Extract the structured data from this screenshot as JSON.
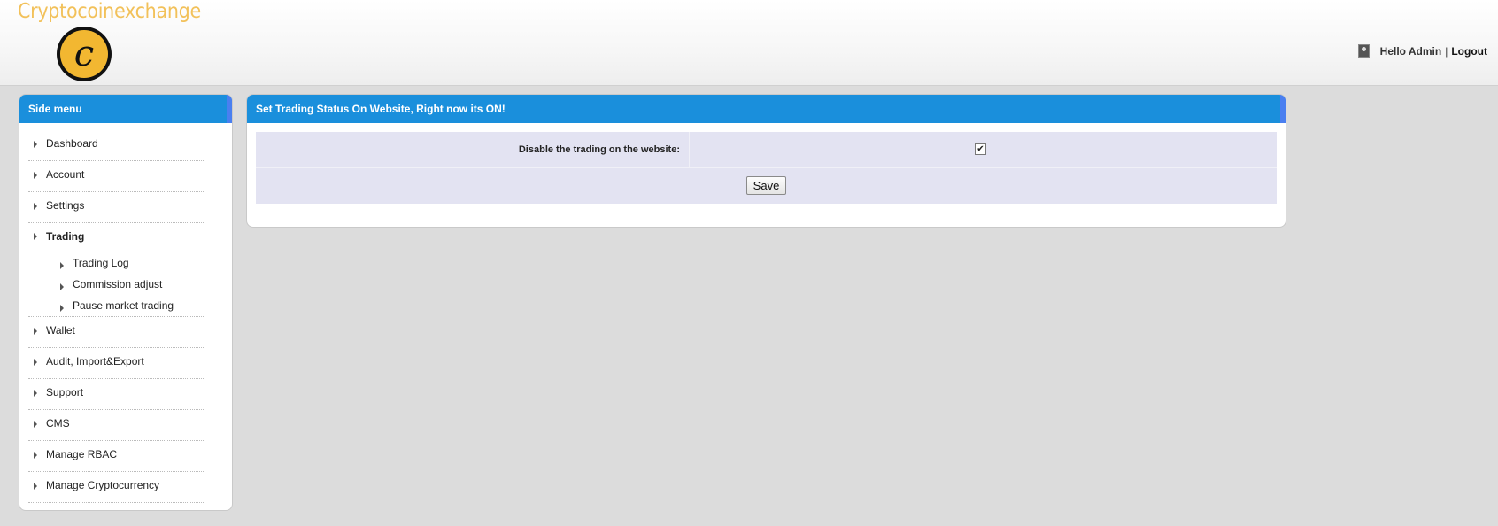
{
  "header": {
    "brand": "Cryptocoinexchange",
    "logo_letter": "c",
    "greeting": "Hello Admin",
    "separator": "|",
    "logout": "Logout"
  },
  "sidebar": {
    "title": "Side menu",
    "items": [
      {
        "label": "Dashboard"
      },
      {
        "label": "Account"
      },
      {
        "label": "Settings"
      },
      {
        "label": "Trading",
        "active": true,
        "children": [
          {
            "label": "Trading Log"
          },
          {
            "label": "Commission adjust"
          },
          {
            "label": "Pause market trading"
          }
        ]
      },
      {
        "label": "Wallet"
      },
      {
        "label": "Audit, Import&Export"
      },
      {
        "label": "Support"
      },
      {
        "label": "CMS"
      },
      {
        "label": "Manage RBAC"
      },
      {
        "label": "Manage Cryptocurrency"
      }
    ]
  },
  "main": {
    "title": "Set Trading Status On Website, Right now its ON!",
    "field_label": "Disable the trading on the website:",
    "checkbox_checked": true,
    "checkbox_mark": "✔",
    "save_label": "Save"
  },
  "colors": {
    "accent": "#1a8fdc",
    "brand": "#f2c15a",
    "form_bg": "#e3e3f2",
    "page_bg": "#dcdcdc"
  }
}
